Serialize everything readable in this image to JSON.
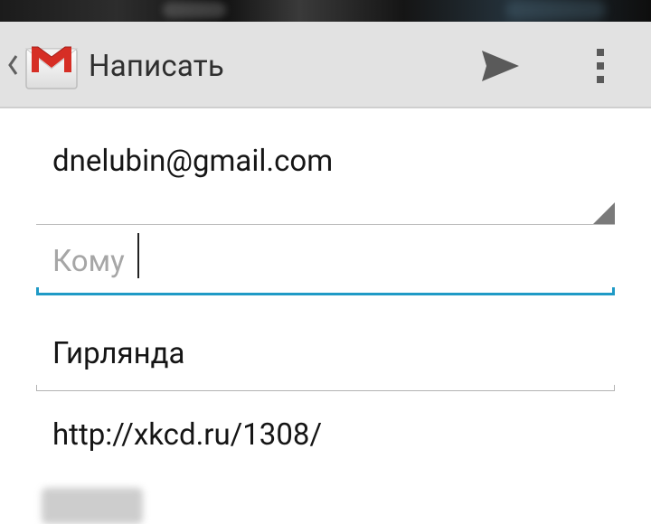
{
  "action_bar": {
    "title": "Написать",
    "up_icon": "chevron-left-icon",
    "app_icon": "gmail-envelope-icon",
    "send_icon": "send-icon",
    "overflow_icon": "overflow-menu-icon",
    "background": "#e2e2e2",
    "brand_red": "#d62e25"
  },
  "compose": {
    "from_account": "dnelubin@gmail.com",
    "to": {
      "value": "",
      "placeholder": "Кому"
    },
    "subject": "Гирлянда",
    "body": "http://xkcd.ru/1308/"
  },
  "colors": {
    "focus_accent": "#1f9ac6",
    "text": "#151515",
    "hint": "#a6a6a6"
  }
}
